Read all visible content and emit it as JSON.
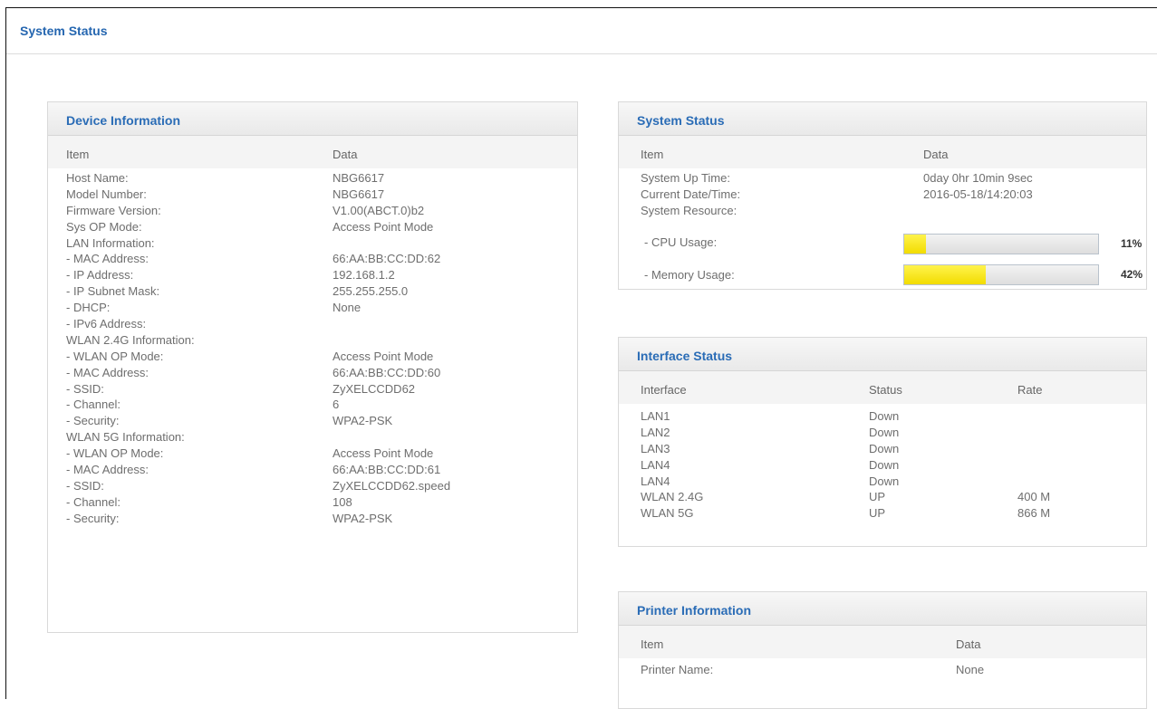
{
  "page": {
    "title": "System Status"
  },
  "device_info": {
    "title": "Device Information",
    "col_item": "Item",
    "col_data": "Data",
    "rows": [
      {
        "item": "Host Name:",
        "data": "NBG6617"
      },
      {
        "item": "Model Number:",
        "data": "NBG6617"
      },
      {
        "item": "Firmware Version:",
        "data": "V1.00(ABCT.0)b2"
      },
      {
        "item": "Sys OP Mode:",
        "data": "Access Point Mode"
      },
      {
        "item": "LAN Information:",
        "data": ""
      },
      {
        "item": " - MAC Address:",
        "data": "66:AA:BB:CC:DD:62"
      },
      {
        "item": " - IP Address:",
        "data": "192.168.1.2"
      },
      {
        "item": " - IP Subnet Mask:",
        "data": "255.255.255.0"
      },
      {
        "item": " - DHCP:",
        "data": "None"
      },
      {
        "item": " - IPv6 Address:",
        "data": ""
      },
      {
        "item": "WLAN 2.4G Information:",
        "data": ""
      },
      {
        "item": " - WLAN OP Mode:",
        "data": "Access Point Mode"
      },
      {
        "item": " - MAC Address:",
        "data": "66:AA:BB:CC:DD:60"
      },
      {
        "item": " - SSID:",
        "data": "ZyXELCCDD62"
      },
      {
        "item": " - Channel:",
        "data": "6"
      },
      {
        "item": " - Security:",
        "data": "WPA2-PSK"
      },
      {
        "item": "WLAN 5G Information:",
        "data": ""
      },
      {
        "item": " - WLAN OP Mode:",
        "data": "Access Point Mode"
      },
      {
        "item": " - MAC Address:",
        "data": "66:AA:BB:CC:DD:61"
      },
      {
        "item": " - SSID:",
        "data": "ZyXELCCDD62.speed"
      },
      {
        "item": " - Channel:",
        "data": "108"
      },
      {
        "item": " - Security:",
        "data": "WPA2-PSK"
      }
    ]
  },
  "system_status": {
    "title": "System Status",
    "col_item": "Item",
    "col_data": "Data",
    "up_time_label": "System Up Time:",
    "up_time_value": "0day 0hr 10min 9sec",
    "date_label": "Current Date/Time:",
    "date_value": "2016-05-18/14:20:03",
    "resource_label": "System Resource:",
    "cpu_label": "- CPU Usage:",
    "cpu_value": 11,
    "cpu_text": "11%",
    "mem_label": "- Memory Usage:",
    "mem_value": 42,
    "mem_text": "42%"
  },
  "interface_status": {
    "title": "Interface Status",
    "col_interface": "Interface",
    "col_status": "Status",
    "col_rate": "Rate",
    "rows": [
      {
        "interface": "LAN1",
        "status": "Down",
        "rate": ""
      },
      {
        "interface": "LAN2",
        "status": "Down",
        "rate": ""
      },
      {
        "interface": "LAN3",
        "status": "Down",
        "rate": ""
      },
      {
        "interface": "LAN4",
        "status": "Down",
        "rate": ""
      },
      {
        "interface": "LAN4",
        "status": "Down",
        "rate": ""
      },
      {
        "interface": "WLAN 2.4G",
        "status": "UP",
        "rate": "400 M"
      },
      {
        "interface": "WLAN 5G",
        "status": "UP",
        "rate": "866 M"
      }
    ]
  },
  "printer_info": {
    "title": "Printer Information",
    "col_item": "Item",
    "col_data": "Data",
    "printer_label": "Printer Name:",
    "printer_value": "None"
  },
  "colors": {
    "title_blue": "#2566b0",
    "progress_yellow": "#f7e800"
  }
}
